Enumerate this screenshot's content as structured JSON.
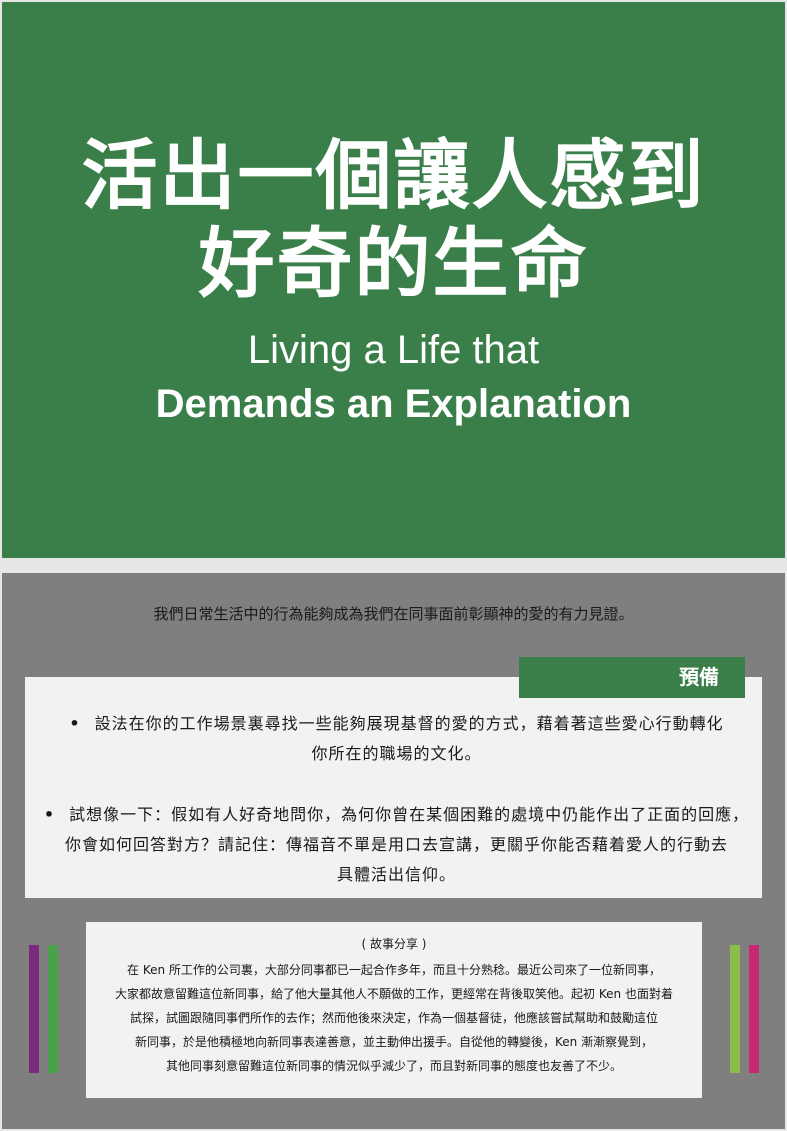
{
  "hero": {
    "title_line1": "活出一個讓人感到",
    "title_line2": "好奇的生命",
    "subtitle_line1": "Living a Life that",
    "subtitle_line2": "Demands an Explanation"
  },
  "intro": "我們日常生活中的行為能夠成為我們在同事面前彰顯神的愛的有力見證。",
  "prepare": {
    "label": "預備",
    "bullet1_line1": "設法在你的工作場景裏尋找一些能夠展現基督的愛的方式，藉着著這些愛心行動轉化",
    "bullet1_line2": "你所在的職場的文化。",
    "bullet2_line1": "試想像一下：假如有人好奇地問你，為何你曾在某個困難的處境中仍能作出了正面的回應，",
    "bullet2_line2": "你會如何回答對方？請記住：傳福音不單是用口去宣講，更關乎你能否藉着愛人的行動去",
    "bullet2_line3": "具體活出信仰。"
  },
  "story": {
    "heading": "( 故事分享 )",
    "line1": "在 Ken 所工作的公司裏，大部分同事都已一起合作多年，而且十分熟稔。最近公司來了一位新同事，",
    "line2": "大家都故意留難這位新同事，給了他大量其他人不願做的工作，更經常在背後取笑他。起初 Ken 也面對着",
    "line3": "試探，試圖跟隨同事們所作的去作；然而他後來決定，作為一個基督徒，他應該嘗試幫助和鼓勵這位",
    "line4": "新同事，於是他積極地向新同事表達善意，並主動伸出援手。自從他的轉變後，Ken 漸漸察覺到，",
    "line5": "其他同事刻意留難這位新同事的情況似乎減少了，而且對新同事的態度也友善了不少。"
  },
  "colors": {
    "primary_green": "#3a7f4a",
    "panel_gray": "#7f7f7f",
    "accent_purple": "#7b2b7e",
    "accent_green": "#4aa149",
    "accent_lime": "#8bbd4a",
    "accent_pink": "#c8286f"
  }
}
